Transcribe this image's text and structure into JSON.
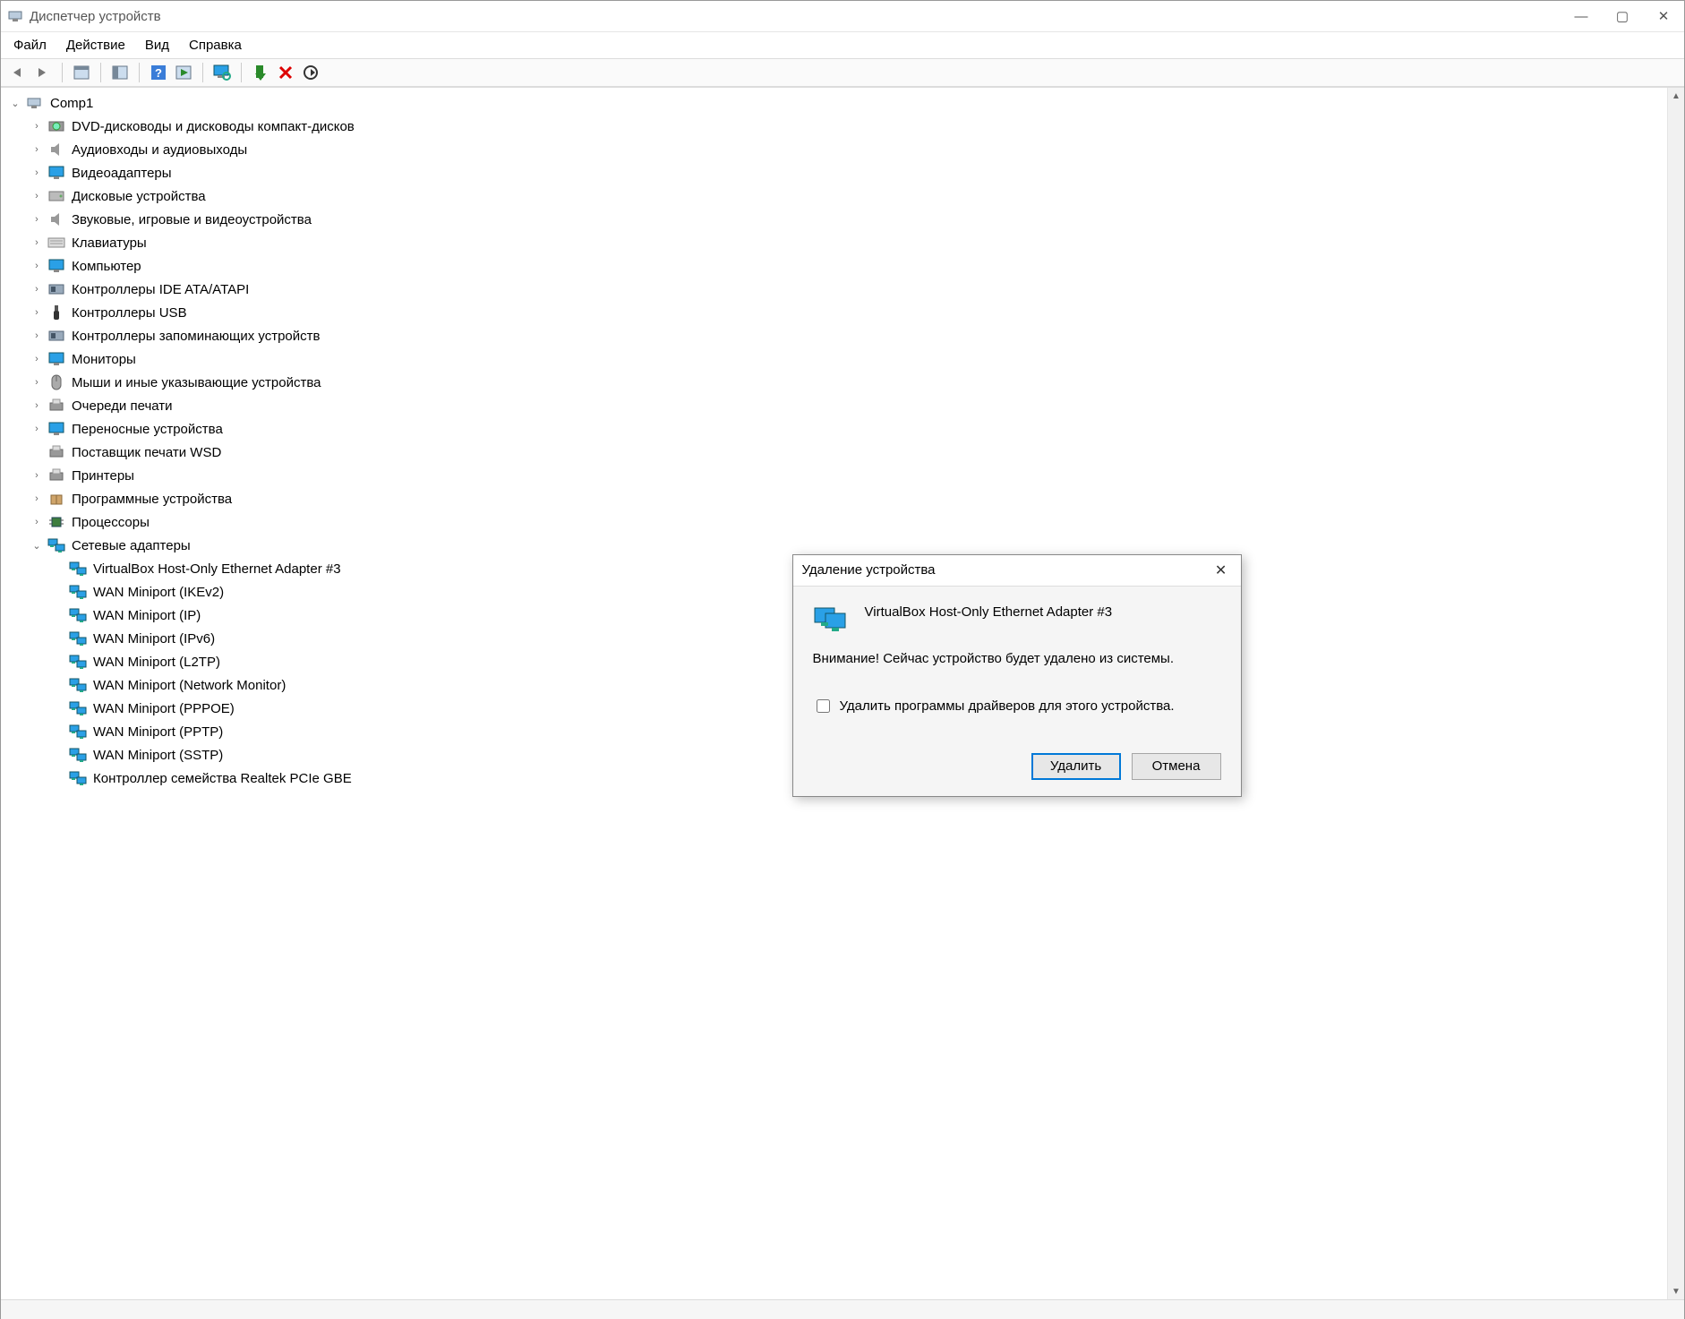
{
  "window": {
    "title": "Диспетчер устройств",
    "controls": {
      "min": "—",
      "max": "▢",
      "close": "✕"
    }
  },
  "menubar": [
    "Файл",
    "Действие",
    "Вид",
    "Справка"
  ],
  "toolbar": {
    "buttons": [
      {
        "name": "nav-back-button",
        "icon": "arrow-left"
      },
      {
        "name": "nav-forward-button",
        "icon": "arrow-right"
      },
      {
        "name": "sep"
      },
      {
        "name": "show-hide-tree-button",
        "icon": "panel"
      },
      {
        "name": "sep"
      },
      {
        "name": "properties-button",
        "icon": "panel2"
      },
      {
        "name": "sep"
      },
      {
        "name": "help-button",
        "icon": "help"
      },
      {
        "name": "action-button",
        "icon": "panel-play"
      },
      {
        "name": "sep"
      },
      {
        "name": "scan-button",
        "icon": "monitor-scan"
      },
      {
        "name": "sep"
      },
      {
        "name": "enable-button",
        "icon": "enable"
      },
      {
        "name": "uninstall-button",
        "icon": "delete-x"
      },
      {
        "name": "update-driver-button",
        "icon": "refresh"
      }
    ]
  },
  "tree": {
    "root": {
      "label": "Comp1",
      "icon": "pc",
      "expanded": true,
      "children": [
        {
          "label": "DVD-дисководы и дисководы компакт-дисков",
          "icon": "disc",
          "expanded": false,
          "children": [
            {}
          ]
        },
        {
          "label": "Аудиовходы и аудиовыходы",
          "icon": "speaker",
          "expanded": false,
          "children": [
            {}
          ]
        },
        {
          "label": "Видеоадаптеры",
          "icon": "monitor",
          "expanded": false,
          "children": [
            {}
          ]
        },
        {
          "label": "Дисковые устройства",
          "icon": "hdd",
          "expanded": false,
          "children": [
            {}
          ]
        },
        {
          "label": "Звуковые, игровые и видеоустройства",
          "icon": "speaker",
          "expanded": false,
          "children": [
            {}
          ]
        },
        {
          "label": "Клавиатуры",
          "icon": "keyboard",
          "expanded": false,
          "children": [
            {}
          ]
        },
        {
          "label": "Компьютер",
          "icon": "monitor",
          "expanded": false,
          "children": [
            {}
          ]
        },
        {
          "label": "Контроллеры IDE ATA/ATAPI",
          "icon": "card",
          "expanded": false,
          "children": [
            {}
          ]
        },
        {
          "label": "Контроллеры USB",
          "icon": "usb",
          "expanded": false,
          "children": [
            {}
          ]
        },
        {
          "label": "Контроллеры запоминающих устройств",
          "icon": "card",
          "expanded": false,
          "children": [
            {}
          ]
        },
        {
          "label": "Мониторы",
          "icon": "monitor",
          "expanded": false,
          "children": [
            {}
          ]
        },
        {
          "label": "Мыши и иные указывающие устройства",
          "icon": "mouse",
          "expanded": false,
          "children": [
            {}
          ]
        },
        {
          "label": "Очереди печати",
          "icon": "printer",
          "expanded": false,
          "children": [
            {}
          ]
        },
        {
          "label": "Переносные устройства",
          "icon": "monitor",
          "expanded": false,
          "children": [
            {}
          ]
        },
        {
          "label": "Поставщик печати WSD",
          "icon": "printer",
          "expanded": false
        },
        {
          "label": "Принтеры",
          "icon": "printer",
          "expanded": false,
          "children": [
            {}
          ]
        },
        {
          "label": "Программные устройства",
          "icon": "box",
          "expanded": false,
          "children": [
            {}
          ]
        },
        {
          "label": "Процессоры",
          "icon": "chip",
          "expanded": false,
          "children": [
            {}
          ]
        },
        {
          "label": "Сетевые адаптеры",
          "icon": "net",
          "expanded": true,
          "children": [
            {
              "label": "VirtualBox Host-Only Ethernet Adapter #3",
              "icon": "net"
            },
            {
              "label": "WAN Miniport (IKEv2)",
              "icon": "net"
            },
            {
              "label": "WAN Miniport (IP)",
              "icon": "net"
            },
            {
              "label": "WAN Miniport (IPv6)",
              "icon": "net"
            },
            {
              "label": "WAN Miniport (L2TP)",
              "icon": "net"
            },
            {
              "label": "WAN Miniport (Network Monitor)",
              "icon": "net"
            },
            {
              "label": "WAN Miniport (PPPOE)",
              "icon": "net"
            },
            {
              "label": "WAN Miniport (PPTP)",
              "icon": "net"
            },
            {
              "label": "WAN Miniport (SSTP)",
              "icon": "net"
            },
            {
              "label": "Контроллер семейства Realtek PCIe GBE",
              "icon": "net"
            }
          ]
        }
      ]
    }
  },
  "dialog": {
    "title": "Удаление устройства",
    "device_name": "VirtualBox Host-Only Ethernet Adapter #3",
    "warning": "Внимание! Сейчас устройство будет удалено из системы.",
    "checkbox_label": "Удалить программы драйверов для этого устройства.",
    "checkbox_checked": false,
    "ok_label": "Удалить",
    "cancel_label": "Отмена"
  }
}
